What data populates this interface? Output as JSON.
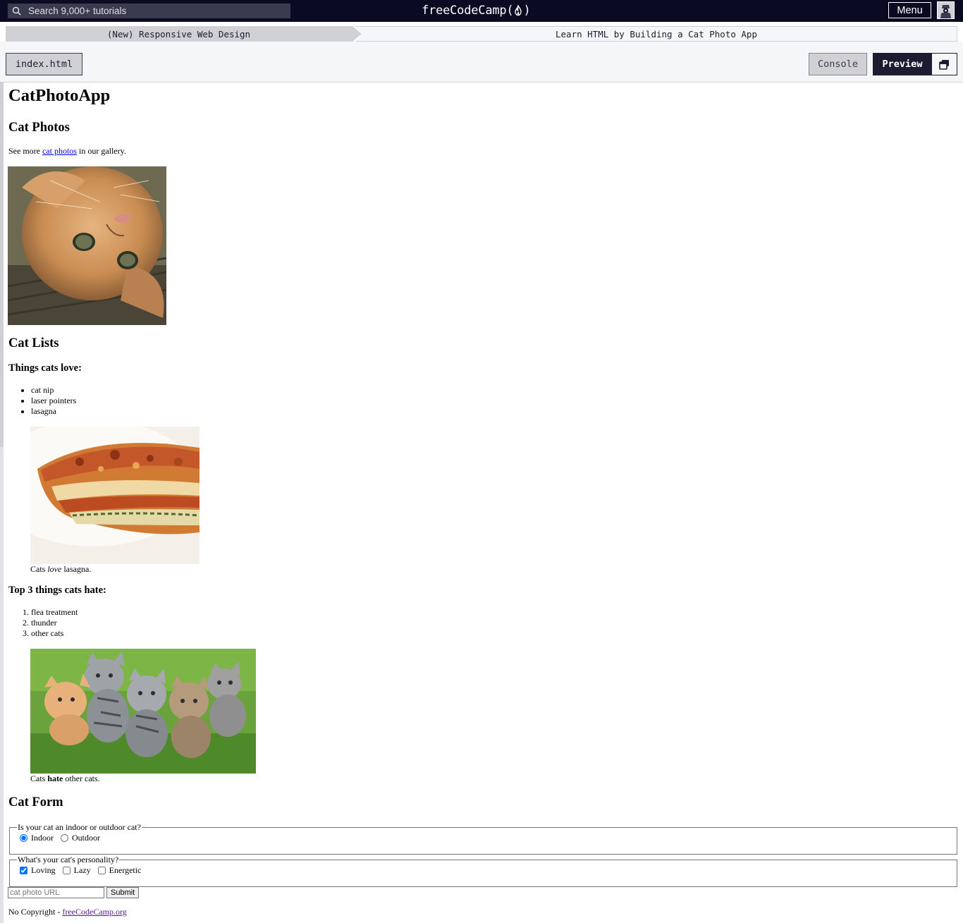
{
  "navbar": {
    "search_placeholder": "Search 9,000+ tutorials",
    "brand_left": "freeCodeCamp(",
    "brand_right": ")",
    "menu_label": "Menu"
  },
  "breadcrumb": {
    "superblock": "(New) Responsive Web Design",
    "challenge": "Learn HTML by Building a Cat Photo App"
  },
  "toolbar": {
    "file_tab": "index.html",
    "console_label": "Console",
    "preview_label": "Preview"
  },
  "preview": {
    "title": "CatPhotoApp",
    "photos_heading": "Cat Photos",
    "see_more_prefix": "See more ",
    "see_more_link": "cat photos",
    "see_more_suffix": " in our gallery.",
    "lists_heading": "Cat Lists",
    "love_heading": "Things cats love:",
    "love_items": [
      "cat nip",
      "laser pointers",
      "lasagna"
    ],
    "lasagna_caption": {
      "before": "Cats ",
      "em": "love",
      "after": " lasagna."
    },
    "hate_heading": "Top 3 things cats hate:",
    "hate_items": [
      "flea treatment",
      "thunder",
      "other cats"
    ],
    "kittens_caption": {
      "before": "Cats ",
      "strong": "hate",
      "after": " other cats."
    },
    "form_heading": "Cat Form",
    "indoor_legend": "Is your cat an indoor or outdoor cat?",
    "indoor_label": "Indoor",
    "outdoor_label": "Outdoor",
    "indoor_checked": true,
    "personality_legend": "What's your cat's personality?",
    "loving_label": "Loving",
    "lazy_label": "Lazy",
    "energetic_label": "Energetic",
    "loving_checked": true,
    "url_placeholder": "cat photo URL",
    "submit_label": "Submit",
    "footer_prefix": "No Copyright - ",
    "footer_link": "freeCodeCamp.org"
  },
  "colors": {
    "nav_bg": "#0a0a23",
    "search_bg": "#3b3b4f",
    "crumb_gray": "#d0d0d5",
    "toolbar_bg": "#f5f6f7",
    "preview_button_bg": "#1b1b32"
  }
}
